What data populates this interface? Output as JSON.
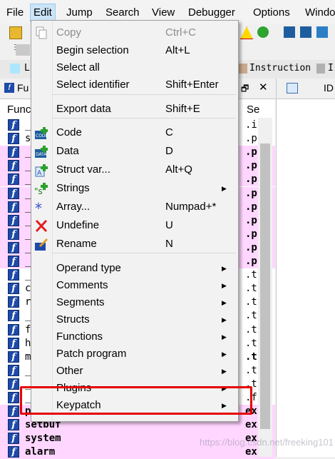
{
  "menubar": {
    "items": [
      "File",
      "Edit",
      "Jump",
      "Search",
      "View",
      "Debugger",
      "Options",
      "Windo"
    ],
    "active": "Edit"
  },
  "toolbar": {
    "legend": {
      "library_function_short": "L",
      "instruction": "Instruction",
      "last_short": "I"
    }
  },
  "functions_pane": {
    "title_short": "Fu",
    "column_function": "Func",
    "column_segment": "Se",
    "rows": [
      {
        "name": "_",
        "segment": ".i"
      },
      {
        "name": "s",
        "segment": ".p"
      },
      {
        "name": "_",
        "segment": ".p"
      },
      {
        "name": "_",
        "segment": ".p"
      },
      {
        "name": "_",
        "segment": ".p"
      },
      {
        "name": "_",
        "segment": ".p"
      },
      {
        "name": "_",
        "segment": ".p"
      },
      {
        "name": "_",
        "segment": ".p"
      },
      {
        "name": "_",
        "segment": ".p"
      },
      {
        "name": "_",
        "segment": ".p"
      },
      {
        "name": "_",
        "segment": ".p"
      },
      {
        "name": "_",
        "segment": ".t"
      },
      {
        "name": "c",
        "segment": ".t"
      },
      {
        "name": "r",
        "segment": ".t"
      },
      {
        "name": "_",
        "segment": ".t"
      },
      {
        "name": "f",
        "segment": ".t"
      },
      {
        "name": "h",
        "segment": ".t"
      },
      {
        "name": "m",
        "segment": ".t"
      },
      {
        "name": "_",
        "segment": ".t"
      },
      {
        "name": "_",
        "segment": ".t"
      },
      {
        "name": "_",
        "segment": ".f"
      },
      {
        "name": "p",
        "segment": "ex"
      },
      {
        "name": "setbuf",
        "segment": "ex"
      },
      {
        "name": "system",
        "segment": "ex"
      },
      {
        "name": "alarm",
        "segment": "ex"
      }
    ]
  },
  "ida_pane": {
    "title_short": "ID"
  },
  "edit_menu": {
    "items": [
      {
        "label": "Copy",
        "shortcut": "Ctrl+C",
        "disabled": true,
        "icon": "copy-icon"
      },
      {
        "label": "Begin selection",
        "shortcut": "Alt+L"
      },
      {
        "label": "Select all",
        "shortcut": ""
      },
      {
        "label": "Select identifier",
        "shortcut": "Shift+Enter"
      },
      {
        "label": "Export data",
        "shortcut": "Shift+E"
      },
      {
        "label": "Code",
        "shortcut": "C",
        "icon": "code-icon"
      },
      {
        "label": "Data",
        "shortcut": "D",
        "icon": "data-icon"
      },
      {
        "label": "Struct var...",
        "shortcut": "Alt+Q",
        "icon": "struct-var-icon"
      },
      {
        "label": "Strings",
        "shortcut": "",
        "submenu": true,
        "icon": "strings-icon"
      },
      {
        "label": "Array...",
        "shortcut": "Numpad+*",
        "icon": "array-icon"
      },
      {
        "label": "Undefine",
        "shortcut": "U",
        "icon": "undefine-icon"
      },
      {
        "label": "Rename",
        "shortcut": "N",
        "icon": "rename-icon"
      },
      {
        "label": "Operand type",
        "submenu": true
      },
      {
        "label": "Comments",
        "submenu": true
      },
      {
        "label": "Segments",
        "submenu": true
      },
      {
        "label": "Structs",
        "submenu": true
      },
      {
        "label": "Functions",
        "submenu": true
      },
      {
        "label": "Patch program",
        "submenu": true
      },
      {
        "label": "Other",
        "submenu": true
      },
      {
        "label": "Plugins",
        "submenu": true
      },
      {
        "label": "Keypatch",
        "submenu": true
      }
    ]
  },
  "watermark": "https://blog.csdn.net/freeking101",
  "colors": {
    "menu_highlight": "#cce4f7",
    "annotation_red": "#e60000",
    "library_pink": "#ffd6ff",
    "function_icon_blue": "#1e4aa8"
  }
}
